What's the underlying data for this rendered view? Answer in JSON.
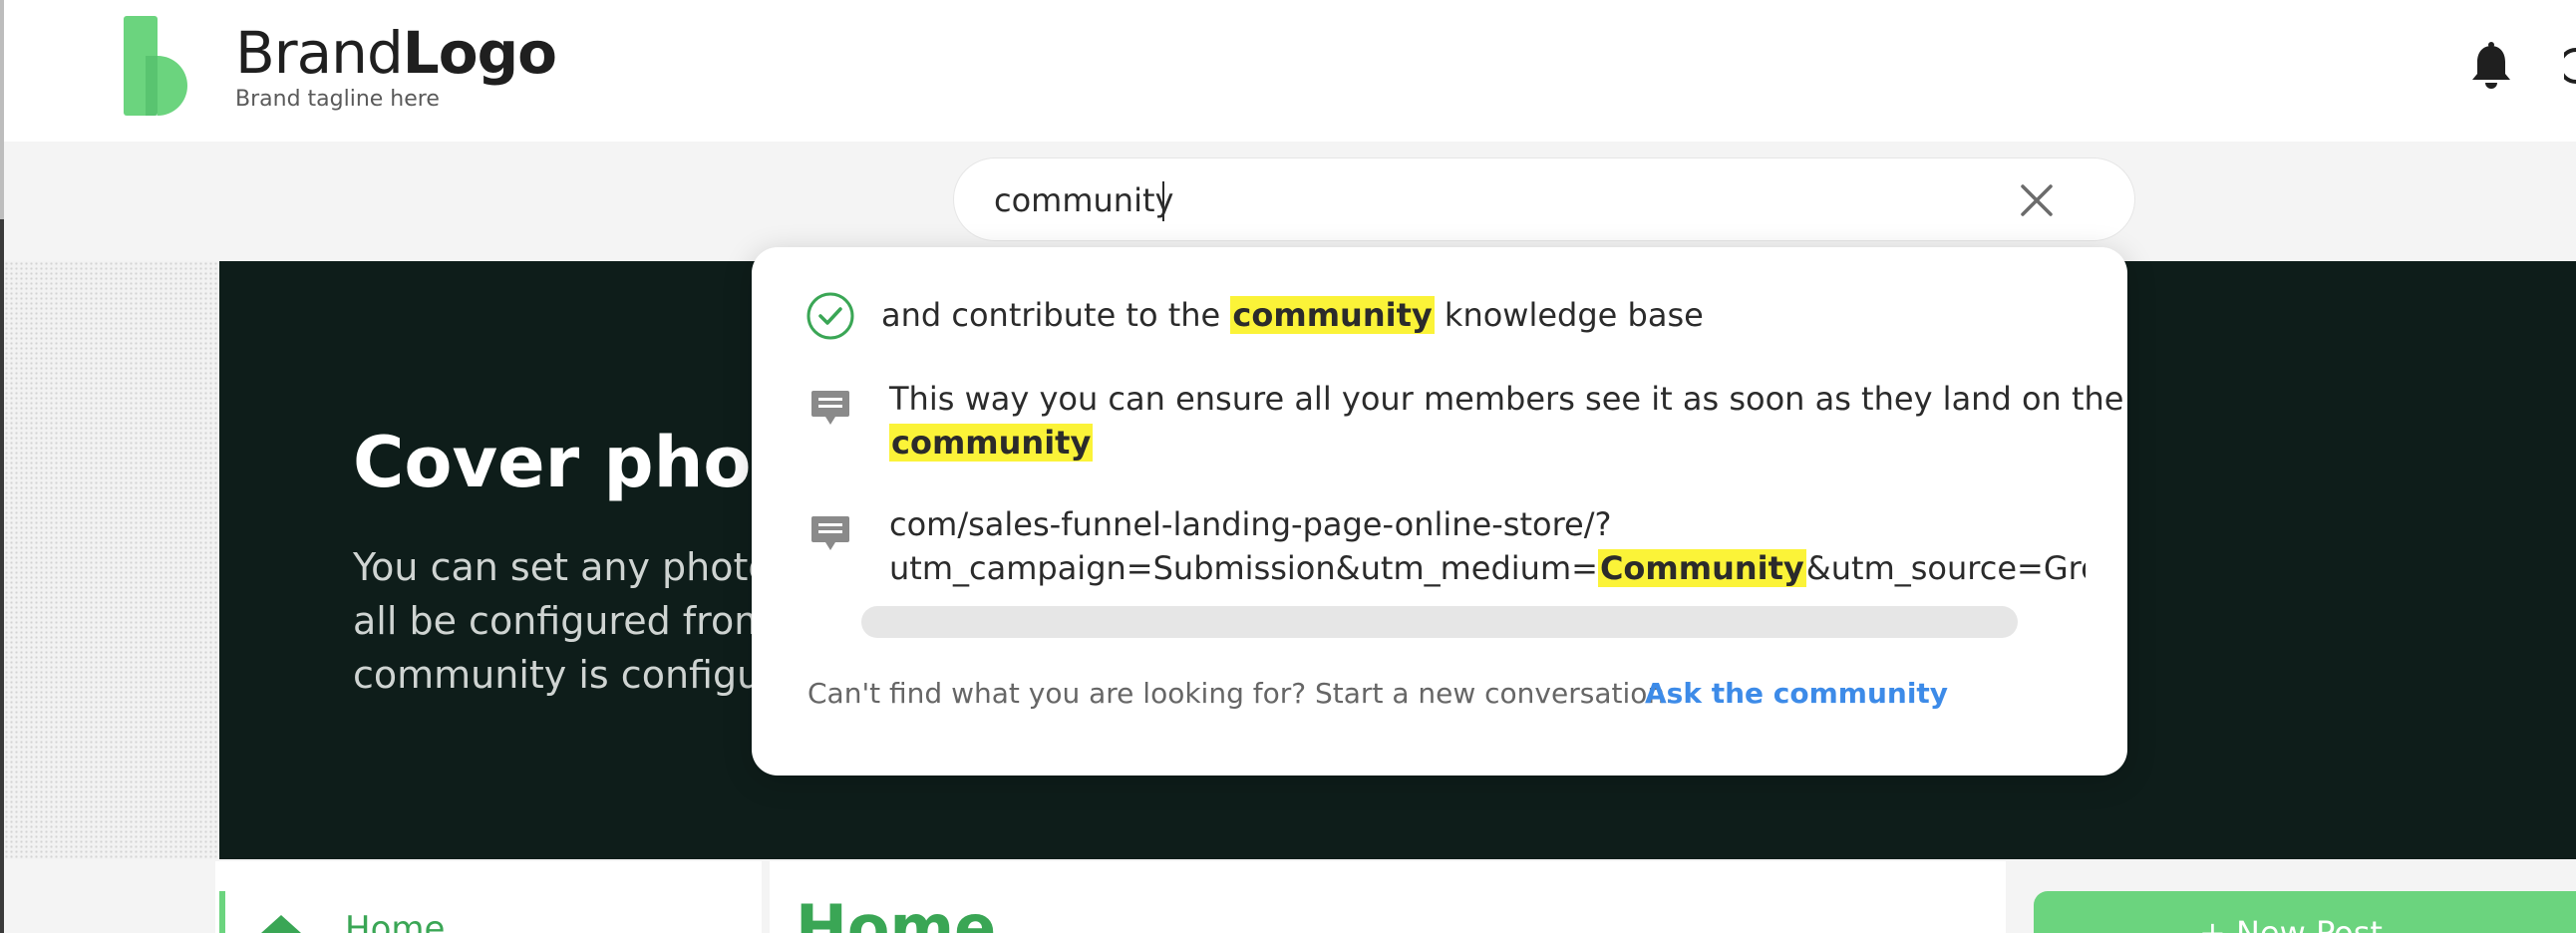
{
  "header": {
    "brand_light": "Brand",
    "brand_bold": "Logo",
    "tagline": "Brand tagline here"
  },
  "search": {
    "value": "community",
    "placeholder": ""
  },
  "results": [
    {
      "type": "answered-question",
      "icon": "check-circle-icon",
      "before": "and contribute to the ",
      "match": "community",
      "after": " knowledge base"
    },
    {
      "type": "comment",
      "icon": "comment-icon",
      "line1": "This way you can ensure all your members see it as soon as they land on the",
      "line2_match": "community"
    },
    {
      "type": "comment",
      "icon": "comment-icon",
      "line1": "com/sales-funnel-landing-page-online-store/?",
      "line2_before": "utm_campaign=Submission&utm_medium=",
      "line2_match": "Community",
      "line2_after": "&utm_source=GrowthHa"
    }
  ],
  "dropdown_footer": {
    "text": "Can't find what you are looking for? Start a new conversation.",
    "link": "Ask the community"
  },
  "hero": {
    "title": "Cover photo",
    "lines": [
      "You can set any photo",
      "all be configured from",
      "community is configu"
    ]
  },
  "sidebar": {
    "home_label": "Home"
  },
  "main": {
    "heading": "Home"
  },
  "actions": {
    "new_post": "+ New Post"
  },
  "colors": {
    "brand_green": "#3aa655",
    "light_green": "#6bd47e",
    "hero_bg": "#0e1d1a",
    "highlight": "#fbf338",
    "link_blue": "#3d8be8"
  }
}
